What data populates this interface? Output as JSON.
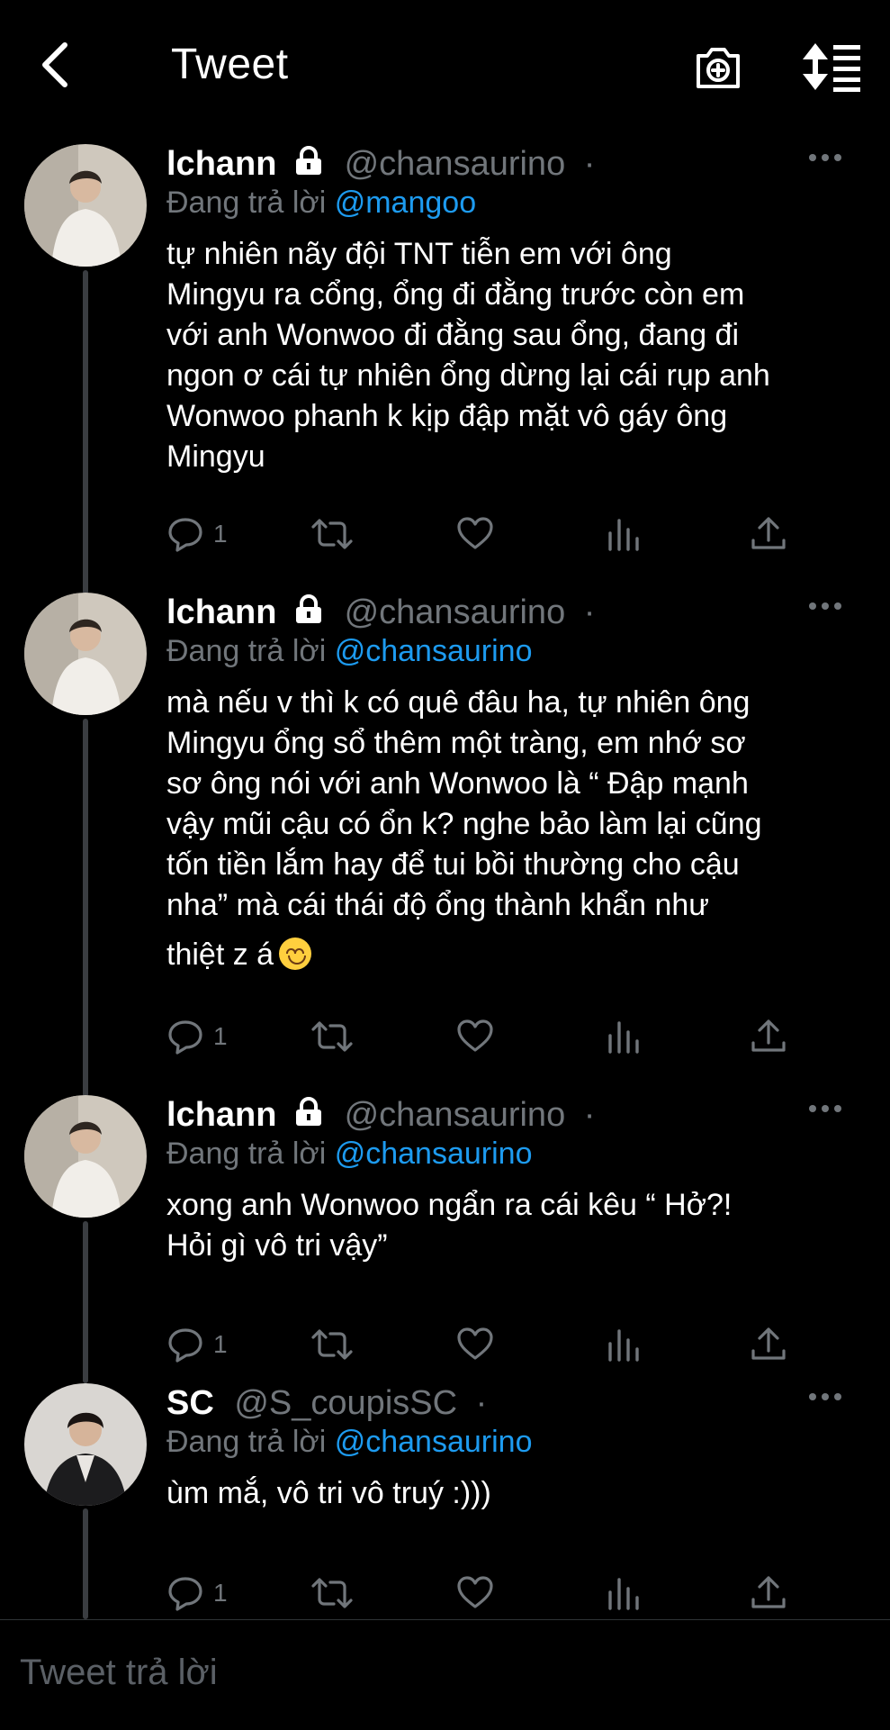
{
  "header": {
    "title": "Tweet"
  },
  "tweets": [
    {
      "name": "lchann",
      "handle": "@chansaurino",
      "dot": "·",
      "reply_prefix": "Đang trả lời",
      "reply_to": "@mangoo",
      "lines": [
        "tự nhiên nãy đội TNT tiễn em với ông",
        "Mingyu ra cổng, ổng đi đằng trước còn em",
        "với anh Wonwoo đi đằng sau ổng, đang đi",
        "ngon ơ cái tự nhiên ổng dừng lại cái rụp anh",
        "Wonwoo phanh k kịp đập mặt vô gáy ông",
        "Mingyu"
      ],
      "reply_count": "1"
    },
    {
      "name": "lchann",
      "handle": "@chansaurino",
      "dot": "·",
      "reply_prefix": "Đang trả lời",
      "reply_to": "@chansaurino",
      "lines": [
        "mà nếu v thì k có quê đâu ha, tự nhiên ông",
        "Mingyu ổng sổ thêm một tràng, em nhớ sơ",
        "sơ ông nói với anh Wonwoo là “ Đập mạnh",
        "vậy mũi cậu có ổn k? nghe bảo làm lại cũng",
        "tốn tiền lắm hay để tui bồi thường cho cậu",
        "nha” mà cái thái độ ổng thành khẩn như",
        "thiệt z á"
      ],
      "emoji": "smiling-face",
      "reply_count": "1"
    },
    {
      "name": "lchann",
      "handle": "@chansaurino",
      "dot": "·",
      "reply_prefix": "Đang trả lời",
      "reply_to": "@chansaurino",
      "lines": [
        "xong anh Wonwoo ngẩn ra cái kêu “ Hở?!",
        "Hỏi gì vô tri vậy”"
      ],
      "reply_count": "1"
    },
    {
      "name": "SC",
      "handle": "@S_coupisSC",
      "dot": "·",
      "reply_prefix": "Đang trả lời",
      "reply_to": "@chansaurino",
      "lines": [
        "ùm mắ, vô tri vô truý :)))"
      ],
      "reply_count": "1"
    }
  ],
  "composer": {
    "placeholder": "Tweet trả lời"
  },
  "colors": {
    "background": "#000000",
    "mention": "#1d9bf0",
    "secondary": "#71767b",
    "thread_line": "#3a3d41"
  },
  "icons": [
    "back-arrow-icon",
    "camera-icon",
    "sort-icon",
    "lock-icon",
    "more-icon",
    "reply-icon",
    "retweet-icon",
    "like-icon",
    "analytics-icon",
    "share-icon"
  ]
}
